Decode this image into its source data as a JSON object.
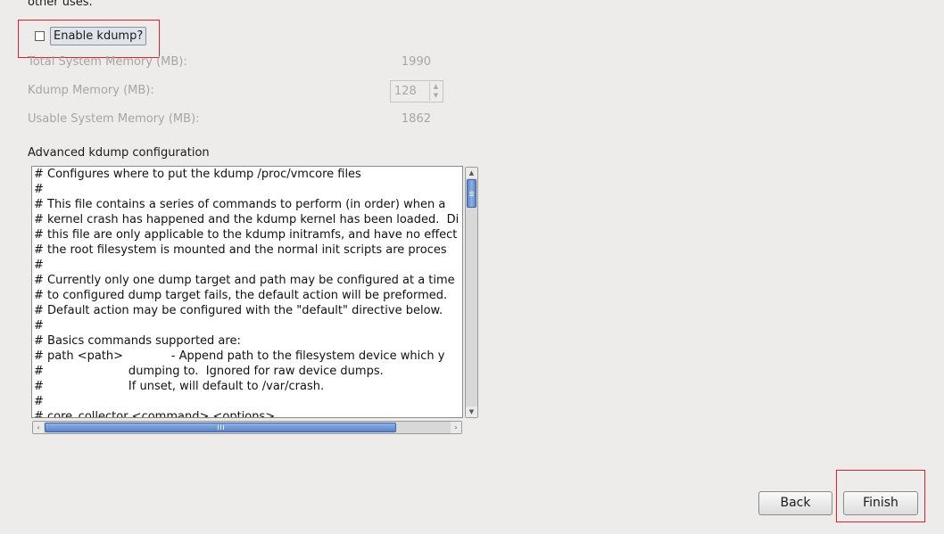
{
  "intro": {
    "text": "other uses."
  },
  "kdump": {
    "enable_label": "Enable kdump?",
    "enabled": false
  },
  "memory": {
    "total_label": "Total System Memory (MB):",
    "total_value": "1990",
    "kdump_label": "Kdump Memory (MB):",
    "kdump_value": "128",
    "usable_label": "Usable System Memory (MB):",
    "usable_value": "1862"
  },
  "advanced": {
    "label": "Advanced kdump configuration",
    "lines": [
      "# Configures where to put the kdump /proc/vmcore files",
      "#",
      "# This file contains a series of commands to perform (in order) when a",
      "# kernel crash has happened and the kdump kernel has been loaded.  Di",
      "# this file are only applicable to the kdump initramfs, and have no effect",
      "# the root filesystem is mounted and the normal init scripts are proces",
      "#",
      "# Currently only one dump target and path may be configured at a time",
      "# to configured dump target fails, the default action will be preformed.",
      "# Default action may be configured with the \"default\" directive below.",
      "#",
      "# Basics commands supported are:",
      "# path <path>             - Append path to the filesystem device which y",
      "#                       dumping to.  Ignored for raw device dumps.",
      "#                       If unset, will default to /var/crash.",
      "#",
      "# core_collector <command> <options>"
    ],
    "vscroll_position": 0.05,
    "hscroll_thumb_fraction": 0.82
  },
  "buttons": {
    "back": "Back",
    "finish": "Finish"
  },
  "colors": {
    "highlight": "#e0202a",
    "scroll_thumb": "#5b84c4",
    "disabled_text": "#a5a5a5"
  }
}
